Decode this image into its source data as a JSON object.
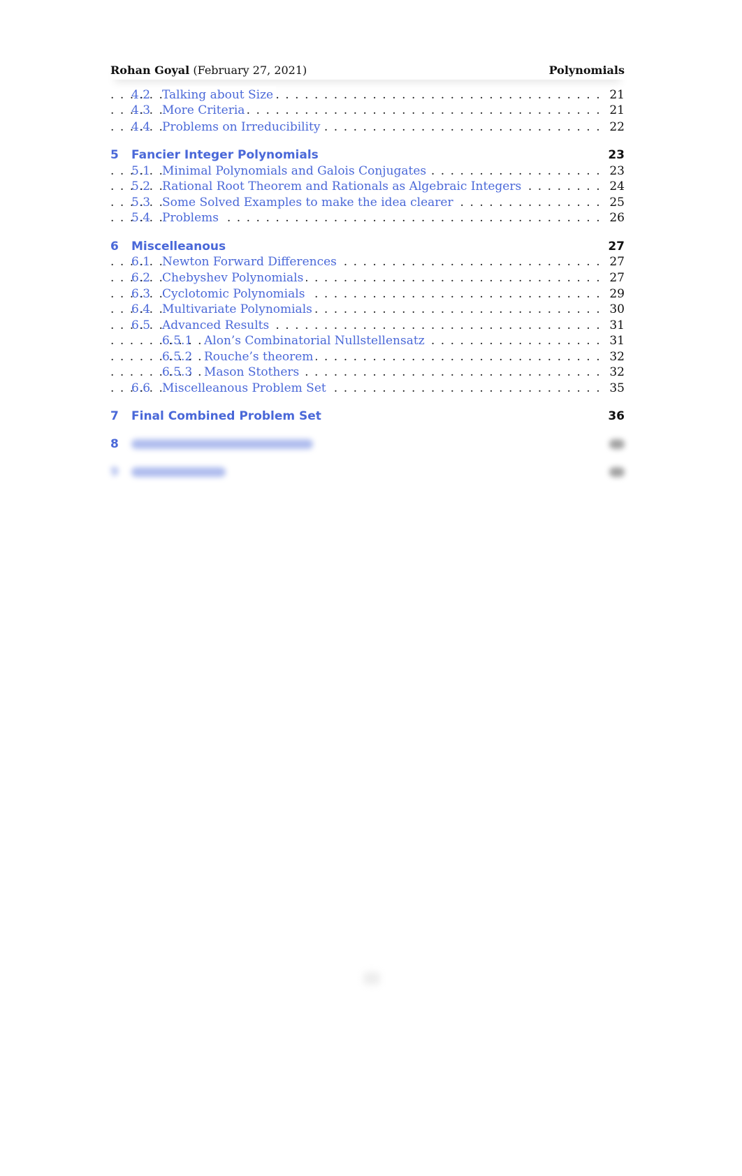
{
  "header": {
    "author": "Rohan Goyal",
    "date": "(February 27, 2021)",
    "title": "Polynomials"
  },
  "toc": [
    {
      "level": "sub",
      "num": "4.2",
      "title": "Talking about Size",
      "page": "21"
    },
    {
      "level": "sub",
      "num": "4.3",
      "title": "More Criteria",
      "page": "21"
    },
    {
      "level": "sub",
      "num": "4.4",
      "title": "Problems on Irreducibility",
      "page": "22"
    },
    {
      "level": "section",
      "num": "5",
      "title": "Fancier Integer Polynomials",
      "page": "23"
    },
    {
      "level": "sub",
      "num": "5.1",
      "title": "Minimal Polynomials and Galois Conjugates",
      "page": "23"
    },
    {
      "level": "sub",
      "num": "5.2",
      "title": "Rational Root Theorem and Rationals as Algebraic Integers",
      "page": "24"
    },
    {
      "level": "sub",
      "num": "5.3",
      "title": "Some Solved Examples to make the idea clearer",
      "page": "25"
    },
    {
      "level": "sub",
      "num": "5.4",
      "title": "Problems",
      "page": "26"
    },
    {
      "level": "section",
      "num": "6",
      "title": "Miscelleanous",
      "page": "27"
    },
    {
      "level": "sub",
      "num": "6.1",
      "title": "Newton Forward Differences",
      "page": "27"
    },
    {
      "level": "sub",
      "num": "6.2",
      "title": "Chebyshev Polynomials",
      "page": "27"
    },
    {
      "level": "sub",
      "num": "6.3",
      "title": "Cyclotomic Polynomials",
      "page": "29"
    },
    {
      "level": "sub",
      "num": "6.4",
      "title": "Multivariate Polynomials",
      "page": "30"
    },
    {
      "level": "sub",
      "num": "6.5",
      "title": "Advanced Results",
      "page": "31"
    },
    {
      "level": "subsub",
      "num": "6.5.1",
      "title": "Alon’s Combinatorial Nullstellensatz",
      "page": "31"
    },
    {
      "level": "subsub",
      "num": "6.5.2",
      "title": "Rouche’s theorem",
      "page": "32"
    },
    {
      "level": "subsub",
      "num": "6.5.3",
      "title": "Mason Stothers",
      "page": "32"
    },
    {
      "level": "sub",
      "num": "6.6",
      "title": "Miscelleanous Problem Set",
      "page": "35"
    },
    {
      "level": "section",
      "num": "7",
      "title": "Final Combined Problem Set",
      "page": "36"
    },
    {
      "level": "section-blurred",
      "num": "8",
      "title": "",
      "page": ""
    },
    {
      "level": "section-blurred",
      "num": "",
      "title": "",
      "page": ""
    }
  ]
}
